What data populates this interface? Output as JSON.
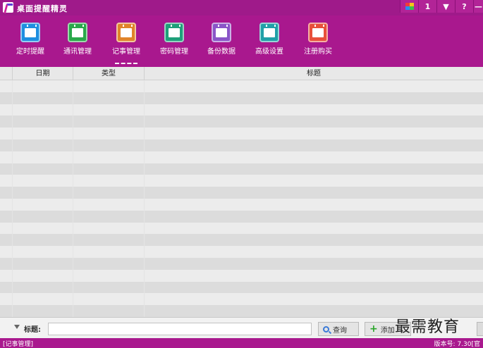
{
  "window": {
    "title": "桌面提醒精灵",
    "buttons": [
      "",
      "1",
      "▼",
      "?",
      "—"
    ]
  },
  "toolbar": {
    "items": [
      {
        "label": "定时提醒",
        "icon": "alarm-clock-icon",
        "color": "#1e8fe0"
      },
      {
        "label": "通讯管理",
        "icon": "address-book-icon",
        "color": "#2aa84a"
      },
      {
        "label": "记事管理",
        "icon": "notepad-icon",
        "color": "#e0842a"
      },
      {
        "label": "密码管理",
        "icon": "password-lock-icon",
        "color": "#1fa07a"
      },
      {
        "label": "备份数据",
        "icon": "backup-disk-icon",
        "color": "#8a55c8"
      },
      {
        "label": "高级设置",
        "icon": "settings-gear-icon",
        "color": "#20a0a8"
      },
      {
        "label": "注册购买",
        "icon": "register-purchase-icon",
        "color": "#e8503a"
      }
    ],
    "active": "记事管理"
  },
  "table": {
    "headers": [
      "日期",
      "类型",
      "标题"
    ],
    "row_count": 20
  },
  "footer": {
    "title_label": "标题:",
    "title_value": "",
    "query_label": "查询",
    "add_label": "添加"
  },
  "watermark": "最需教育",
  "status": {
    "left": "[记事管理]",
    "right": "版本号: 7.30[官"
  }
}
